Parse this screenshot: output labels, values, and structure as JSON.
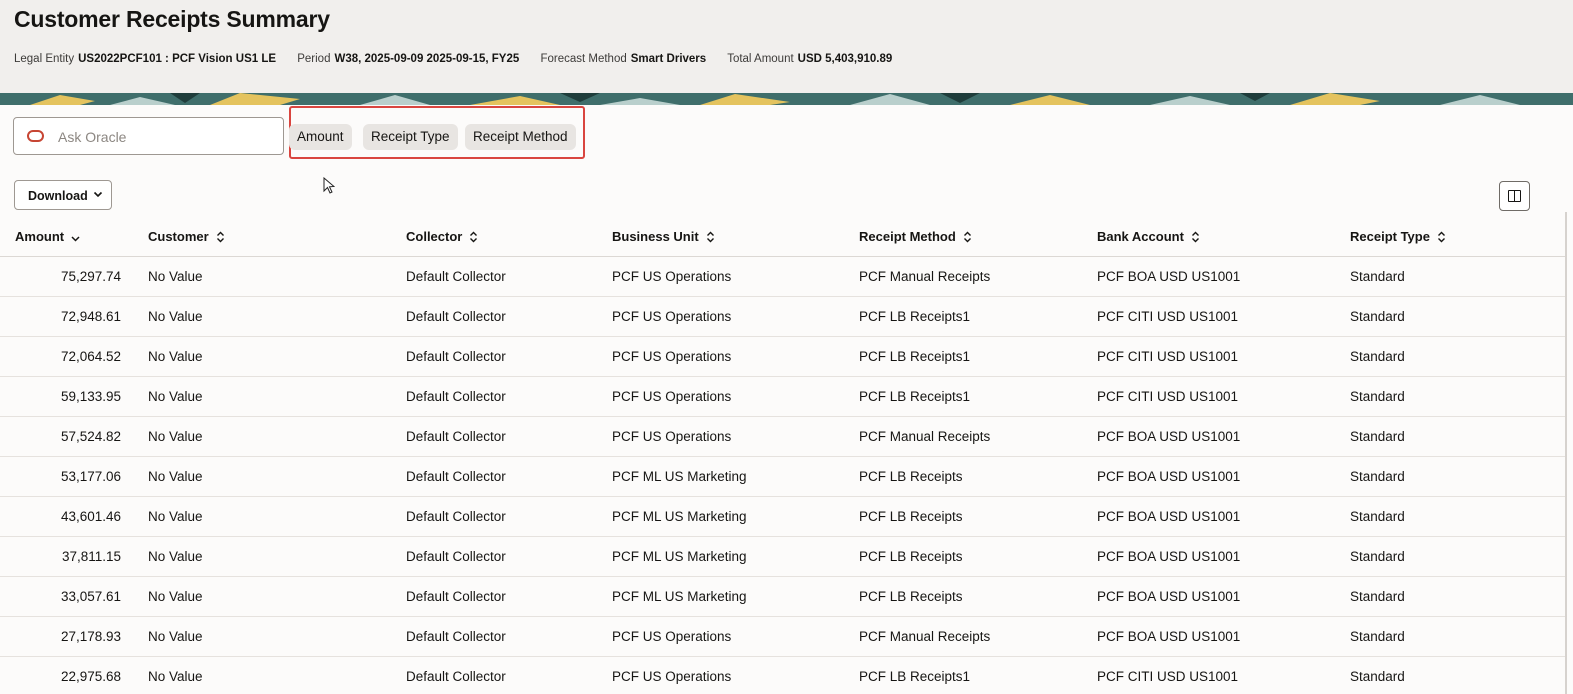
{
  "page": {
    "title": "Customer Receipts Summary",
    "meta": [
      {
        "label": "Legal Entity",
        "value": "US2022PCF101 : PCF Vision US1 LE"
      },
      {
        "label": "Period",
        "value": "W38, 2025-09-09 2025-09-15, FY25"
      },
      {
        "label": "Forecast Method",
        "value": "Smart Drivers"
      },
      {
        "label": "Total Amount",
        "value": "USD 5,403,910.89"
      }
    ]
  },
  "ask": {
    "placeholder": "Ask Oracle",
    "icon": "oracle-ring-icon"
  },
  "chips": [
    {
      "label": "Amount"
    },
    {
      "label": "Receipt Type"
    },
    {
      "label": "Receipt Method"
    }
  ],
  "toolbar": {
    "download_label": "Download",
    "columns_icon": "column-layout-icon"
  },
  "table": {
    "columns": [
      "Amount",
      "Customer",
      "Collector",
      "Business Unit",
      "Receipt Method",
      "Bank Account",
      "Receipt Type"
    ],
    "rows": [
      [
        "75,297.74",
        "No Value",
        "Default Collector",
        "PCF US Operations",
        "PCF Manual Receipts",
        "PCF BOA USD US1001",
        "Standard"
      ],
      [
        "72,948.61",
        "No Value",
        "Default Collector",
        "PCF US Operations",
        "PCF LB Receipts1",
        "PCF CITI USD US1001",
        "Standard"
      ],
      [
        "72,064.52",
        "No Value",
        "Default Collector",
        "PCF US Operations",
        "PCF LB Receipts1",
        "PCF CITI USD US1001",
        "Standard"
      ],
      [
        "59,133.95",
        "No Value",
        "Default Collector",
        "PCF US Operations",
        "PCF LB Receipts1",
        "PCF CITI USD US1001",
        "Standard"
      ],
      [
        "57,524.82",
        "No Value",
        "Default Collector",
        "PCF US Operations",
        "PCF Manual Receipts",
        "PCF BOA USD US1001",
        "Standard"
      ],
      [
        "53,177.06",
        "No Value",
        "Default Collector",
        "PCF ML US Marketing",
        "PCF LB Receipts",
        "PCF BOA USD US1001",
        "Standard"
      ],
      [
        "43,601.46",
        "No Value",
        "Default Collector",
        "PCF ML US Marketing",
        "PCF LB Receipts",
        "PCF BOA USD US1001",
        "Standard"
      ],
      [
        "37,811.15",
        "No Value",
        "Default Collector",
        "PCF ML US Marketing",
        "PCF LB Receipts",
        "PCF BOA USD US1001",
        "Standard"
      ],
      [
        "33,057.61",
        "No Value",
        "Default Collector",
        "PCF ML US Marketing",
        "PCF LB Receipts",
        "PCF BOA USD US1001",
        "Standard"
      ],
      [
        "27,178.93",
        "No Value",
        "Default Collector",
        "PCF US Operations",
        "PCF Manual Receipts",
        "PCF BOA USD US1001",
        "Standard"
      ],
      [
        "22,975.68",
        "No Value",
        "Default Collector",
        "PCF US Operations",
        "PCF LB Receipts1",
        "PCF CITI USD US1001",
        "Standard"
      ]
    ]
  },
  "colors": {
    "accent": "#c74634",
    "highlight_box": "#d9453f",
    "header_bg": "#f1efed",
    "chip_bg": "#e8e5e2"
  }
}
